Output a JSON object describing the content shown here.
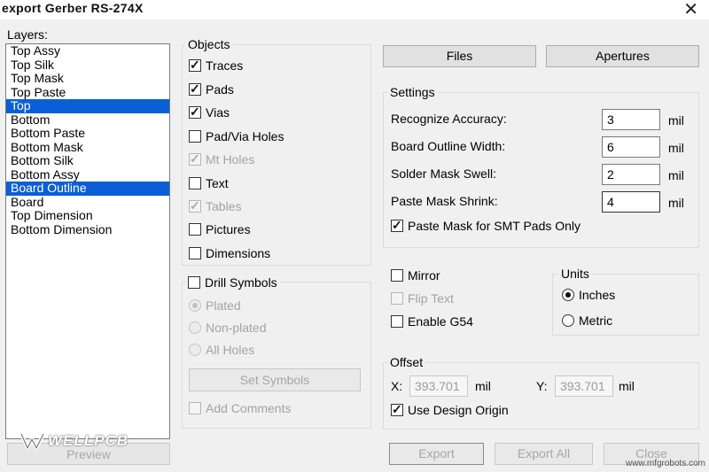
{
  "title": "export Gerber RS-274X",
  "layers": {
    "label": "Layers:",
    "items": [
      {
        "label": "Top Assy",
        "selected": false
      },
      {
        "label": "Top Silk",
        "selected": false
      },
      {
        "label": "Top Mask",
        "selected": false
      },
      {
        "label": "Top Paste",
        "selected": false
      },
      {
        "label": "Top",
        "selected": true
      },
      {
        "label": "Bottom",
        "selected": false
      },
      {
        "label": "Bottom Paste",
        "selected": false
      },
      {
        "label": "Bottom Mask",
        "selected": false
      },
      {
        "label": "Bottom Silk",
        "selected": false
      },
      {
        "label": "Bottom Assy",
        "selected": false
      },
      {
        "label": "Board Outline",
        "selected": true
      },
      {
        "label": "Board",
        "selected": false
      },
      {
        "label": "Top Dimension",
        "selected": false
      },
      {
        "label": "Bottom Dimension",
        "selected": false
      }
    ],
    "preview_label": "Preview"
  },
  "objects": {
    "title": "Objects",
    "items": [
      {
        "label": "Traces",
        "checked": true,
        "disabled": false
      },
      {
        "label": "Pads",
        "checked": true,
        "disabled": false
      },
      {
        "label": "Vias",
        "checked": true,
        "disabled": false
      },
      {
        "label": "Pad/Via Holes",
        "checked": false,
        "disabled": false
      },
      {
        "label": "Mt Holes",
        "checked": true,
        "disabled": true
      },
      {
        "label": "Text",
        "checked": false,
        "disabled": false
      },
      {
        "label": "Tables",
        "checked": true,
        "disabled": true
      },
      {
        "label": "Pictures",
        "checked": false,
        "disabled": false
      },
      {
        "label": "Dimensions",
        "checked": false,
        "disabled": false
      }
    ]
  },
  "drill": {
    "label": "Drill Symbols",
    "options": [
      "Plated",
      "Non-plated",
      "All Holes"
    ],
    "selected": "Plated",
    "set_symbols_label": "Set Symbols",
    "add_comments_label": "Add Comments"
  },
  "buttons": {
    "files": "Files",
    "apertures": "Apertures",
    "export": "Export",
    "export_all": "Export All",
    "close": "Close"
  },
  "settings": {
    "title": "Settings",
    "fields": [
      {
        "label": "Recognize Accuracy:",
        "value": "3",
        "unit": "mil"
      },
      {
        "label": "Board Outline Width:",
        "value": "6",
        "unit": "mil"
      },
      {
        "label": "Solder Mask Swell:",
        "value": "2",
        "unit": "mil"
      },
      {
        "label": "Paste Mask Shrink:",
        "value": "4",
        "unit": "mil"
      }
    ],
    "paste_smt_label": "Paste Mask for SMT Pads Only",
    "paste_smt_checked": true
  },
  "options": {
    "mirror": {
      "label": "Mirror",
      "checked": false
    },
    "flip_text": {
      "label": "Flip Text",
      "checked": false
    },
    "enable_g54": {
      "label": "Enable G54",
      "checked": false
    }
  },
  "units": {
    "title": "Units",
    "options": [
      "Inches",
      "Metric"
    ],
    "selected": "Inches"
  },
  "offset": {
    "title": "Offset",
    "x_label": "X:",
    "x_value": "393.701",
    "x_unit": "mil",
    "y_label": "Y:",
    "y_value": "393.701",
    "y_unit": "mil",
    "use_design_origin_label": "Use Design Origin",
    "use_design_origin_checked": true
  },
  "brand": {
    "logo_text": "WELLPCB"
  },
  "watermark": "www.mfgrobots.com",
  "colors": {
    "selection": "#0a5fd6",
    "dialog_bg": "#f0f0f0"
  }
}
